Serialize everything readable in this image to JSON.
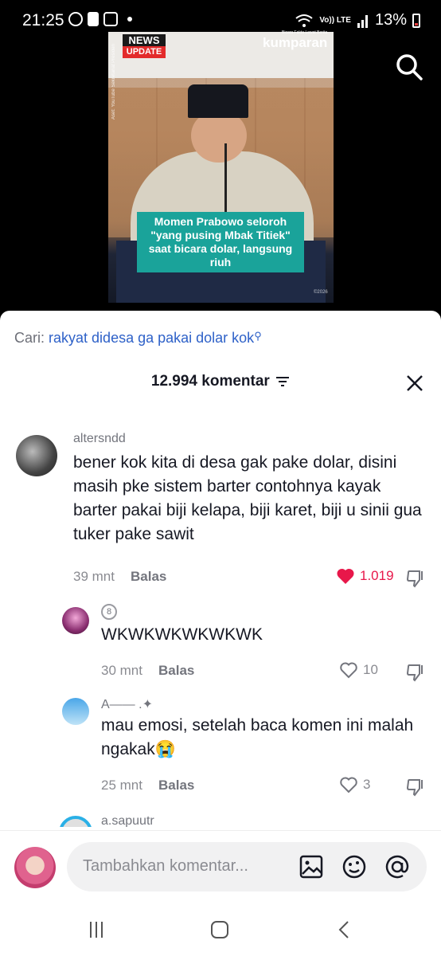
{
  "status": {
    "time": "21:25",
    "battery": "13%",
    "volte": "Vo)) LTE"
  },
  "video": {
    "news_line1": "NEWS",
    "news_line2": "UPDATE",
    "brand_tag": "Bicara Fakta Lewat Berita",
    "brand": "kumparan",
    "credit": "Aset: YouTube Sekretariat Presiden",
    "caption": "Momen Prabowo seloroh \"yang pusing Mbak Titiek\" saat bicara dolar, langsung riuh",
    "watermark": "©2026"
  },
  "search": {
    "label": "Cari:",
    "query": "rakyat didesa ga pakai dolar kok"
  },
  "header": {
    "count_label": "12.994 komentar"
  },
  "comments": [
    {
      "username": "altersndd",
      "text": "bener kok kita di desa gak pake dolar, disini masih pke sistem barter contohnya kayak barter pakai biji kelapa, biji karet, biji u sinii gua tuker pake sawit",
      "time": "39 mnt",
      "reply": "Balas",
      "likes": "1.019",
      "liked": true
    },
    {
      "username": "8",
      "text": "WKWKWKWKWKWK",
      "time": "30 mnt",
      "reply": "Balas",
      "likes": "10",
      "liked": false
    },
    {
      "username": "A—— .✦",
      "text": "mau emosi, setelah baca komen ini malah ngakak😭",
      "time": "25 mnt",
      "reply": "Balas",
      "likes": "3",
      "liked": false
    },
    {
      "username": "a.sapuutr"
    }
  ],
  "input": {
    "placeholder": "Tambahkan komentar..."
  },
  "colors": {
    "accent": "#e8174a",
    "link": "#2e61c8",
    "caption_bg": "#1aa39a"
  }
}
